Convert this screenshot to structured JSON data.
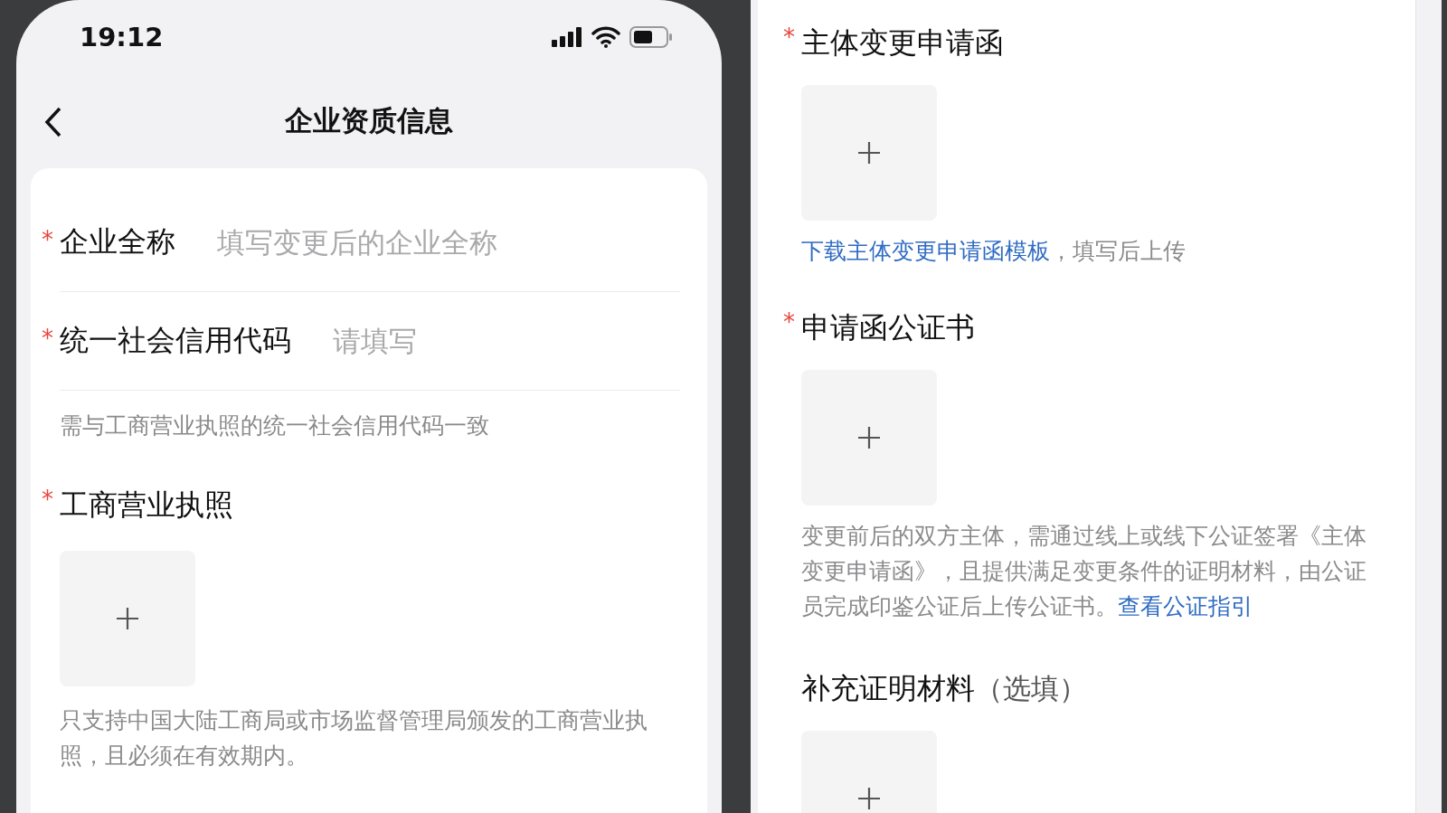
{
  "left_screen": {
    "status_bar": {
      "time": "19:12"
    },
    "nav_bar": {
      "title": "企业资质信息"
    },
    "fields": [
      {
        "label": "企业全称",
        "required_mark": "*",
        "placeholder": "填写变更后的企业全称"
      },
      {
        "label": "统一社会信用代码",
        "required_mark": "*",
        "placeholder": "请填写"
      }
    ],
    "field_hint": "需与工商营业执照的统一社会信用代码一致",
    "upload": {
      "label": "工商营业执照",
      "required_mark": "*",
      "note": "只支持中国大陆工商局或市场监督管理局颁发的工商营业执照，且必须在有效期内。"
    }
  },
  "right_screen": {
    "uploads": [
      {
        "label": "主体变更申请函",
        "required_mark": "*",
        "note_parts": [
          {
            "kind": "link",
            "text": "下载主体变更申请函模板"
          },
          {
            "kind": "text",
            "text": "，填写后上传"
          }
        ]
      },
      {
        "label": "申请函公证书",
        "required_mark": "*",
        "note_parts": [
          {
            "kind": "text",
            "text": "变更前后的双方主体，需通过线上或线下公证签署《主体变更申请函》，且提供满足变更条件的证明材料，由公证员完成印鉴公证后上传公证书。"
          },
          {
            "kind": "link",
            "text": "查看公证指引"
          }
        ]
      },
      {
        "label": "补充证明材料",
        "optional": "（选填）"
      }
    ]
  }
}
